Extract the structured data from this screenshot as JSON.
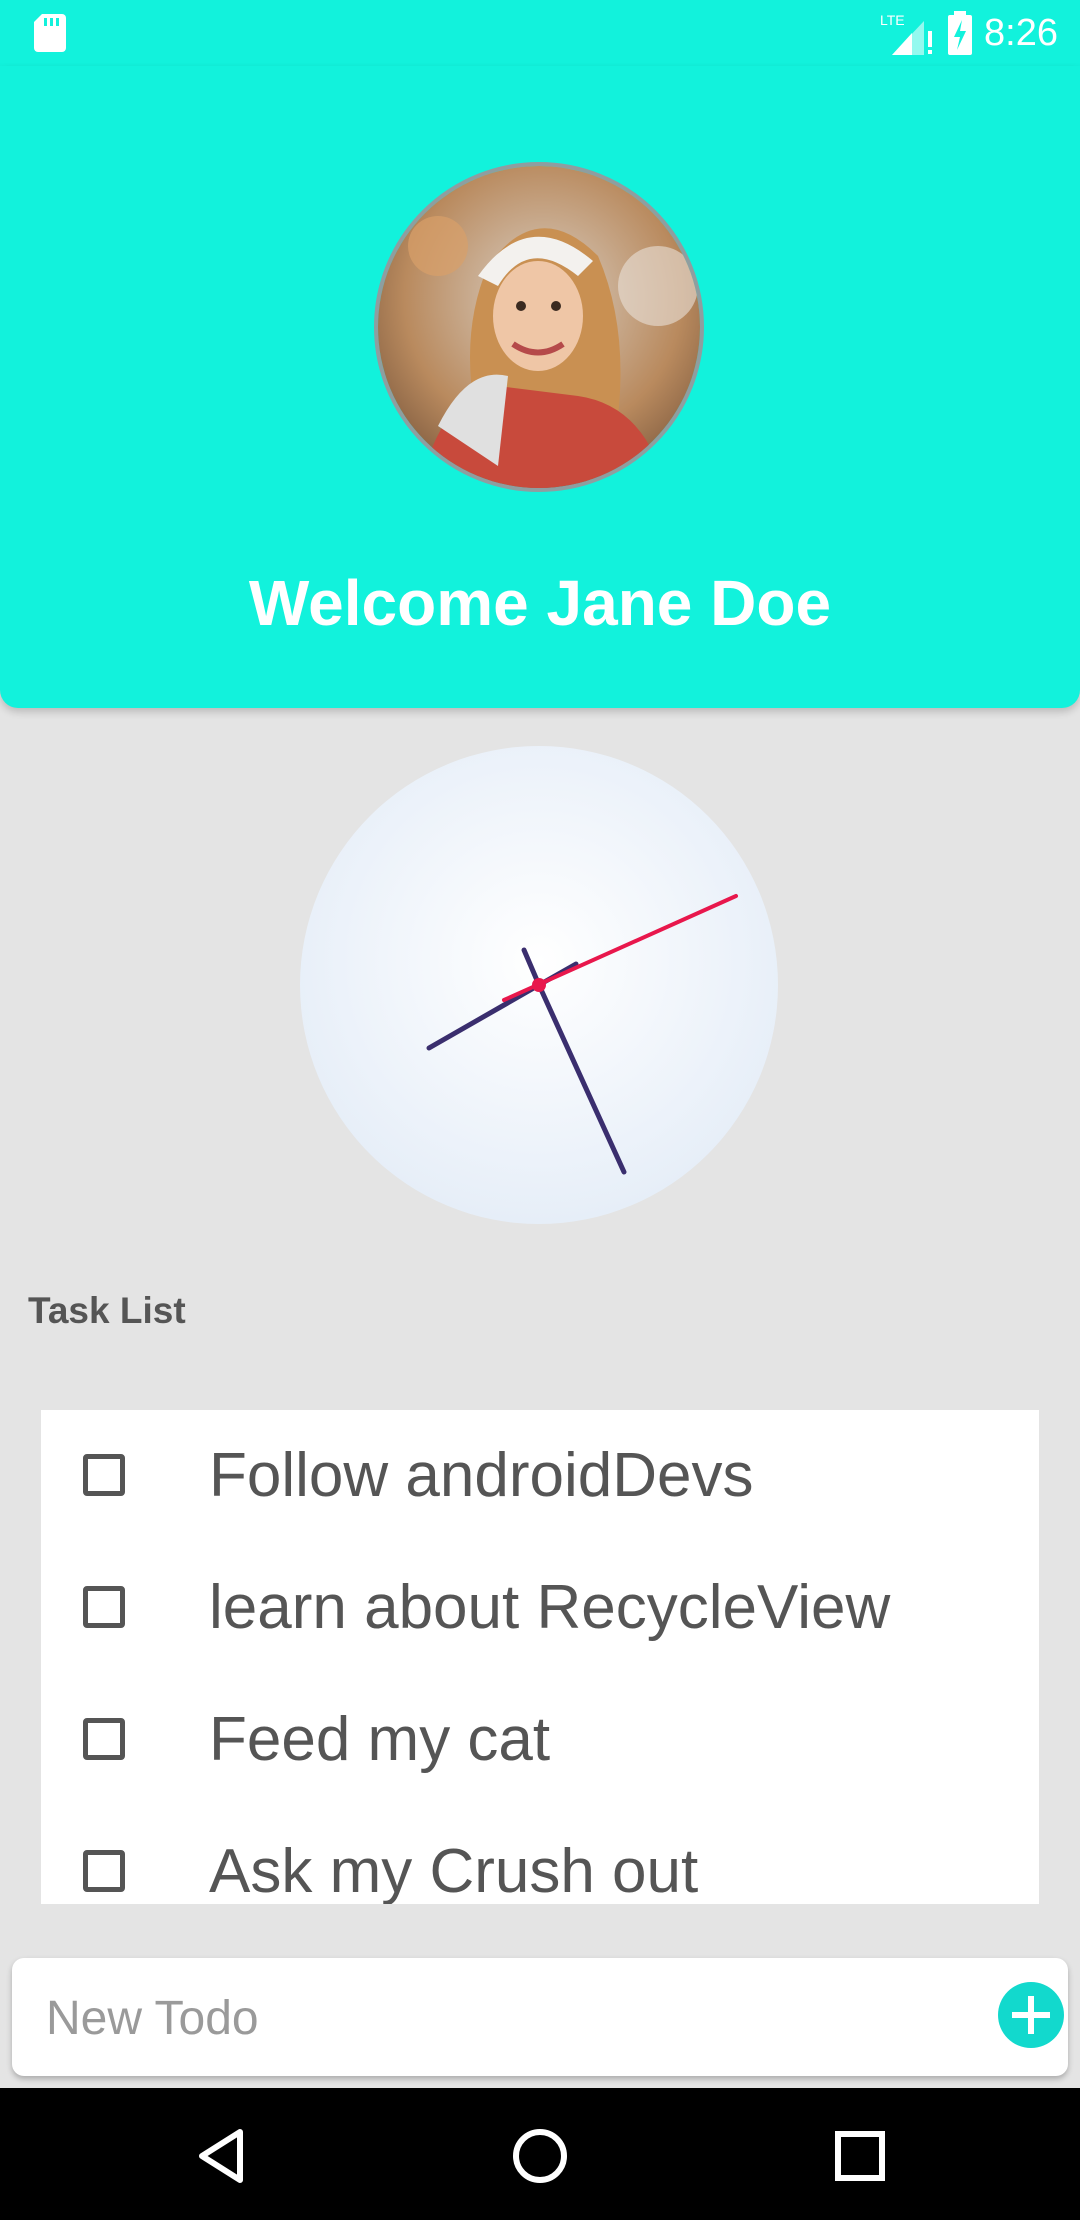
{
  "status_bar": {
    "time": "8:26",
    "network_label": "LTE",
    "icons": [
      "sd-card-icon",
      "signal-icon",
      "battery-charging-icon"
    ]
  },
  "header": {
    "welcome": "Welcome Jane Doe",
    "avatar_icon": "profile-photo"
  },
  "clock": {
    "hour_hand_color": "#3a2e6e",
    "second_hand_color": "#e8174c"
  },
  "tasks": {
    "title": "Task List",
    "items": [
      {
        "label": "Follow androidDevs",
        "checked": false
      },
      {
        "label": "learn about RecycleView",
        "checked": false
      },
      {
        "label": "Feed my cat",
        "checked": false
      },
      {
        "label": "Ask my Crush out",
        "checked": false
      }
    ]
  },
  "new_todo": {
    "placeholder": "New Todo",
    "value": "",
    "add_icon": "plus-icon"
  },
  "nav": {
    "icons": [
      "back-icon",
      "home-icon",
      "recents-icon"
    ]
  },
  "colors": {
    "accent": "#12f2dc",
    "background": "#e4e4e4"
  }
}
